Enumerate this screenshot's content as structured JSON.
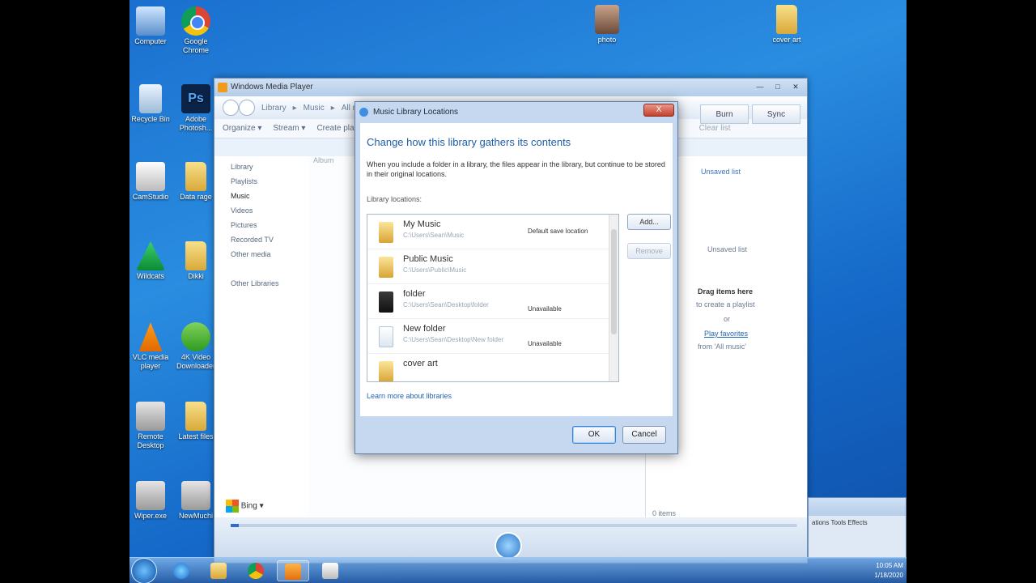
{
  "desktop": {
    "icons": [
      {
        "label": "Computer"
      },
      {
        "label": "Google Chrome"
      },
      {
        "label": "photo"
      },
      {
        "label": "cover art"
      },
      {
        "label": "Recycle Bin"
      },
      {
        "label": "Adobe Photosh..."
      },
      {
        "label": "CamStudio"
      },
      {
        "label": "Data rage"
      },
      {
        "label": "Wildcats"
      },
      {
        "label": "Dikki"
      },
      {
        "label": "VLC media player"
      },
      {
        "label": "4K Video Downloader"
      },
      {
        "label": "Remote Desktop"
      },
      {
        "label": "Latest files"
      },
      {
        "label": "Wiper.exe"
      },
      {
        "label": "NewMuchi"
      }
    ]
  },
  "wmp": {
    "title": "Windows Media Player",
    "breadcrumb": [
      "Library",
      "Music",
      "All m"
    ],
    "tabs": [
      "Burn",
      "Sync"
    ],
    "toolbar": [
      "Organize",
      "Stream",
      "Create pla"
    ],
    "clear_list": "Clear list",
    "column_header": "Album",
    "sidebar": [
      "Library",
      "Playlists",
      "Music",
      "Videos",
      "Pictures",
      "Recorded TV",
      "Other media",
      "Other Libraries"
    ],
    "right_panel": {
      "unsaved_list_link": "Unsaved list",
      "unsaved_list_title": "Unsaved list",
      "drag_title": "Drag items here",
      "drag_sub": "to create a playlist",
      "or": "or",
      "play_favorites": "Play favorites",
      "play_favorites_from": "from 'All music'",
      "item_count": "0 items"
    },
    "bing": "Bing"
  },
  "dialog": {
    "title": "Music Library Locations",
    "close_label": "X",
    "heading": "Change how this library gathers its contents",
    "description": "When you include a folder in a library, the files appear in the library, but continue to be stored in their original locations.",
    "locations_label": "Library locations:",
    "locations": [
      {
        "name": "My Music",
        "path": "C:\\Users\\Sean\\Music",
        "status": "Default save location"
      },
      {
        "name": "Public Music",
        "path": "C:\\Users\\Public\\Music",
        "status": ""
      },
      {
        "name": "folder",
        "path": "C:\\Users\\Sean\\Desktop\\folder",
        "status": "Unavailable"
      },
      {
        "name": "New folder",
        "path": "C:\\Users\\Sean\\Desktop\\New folder",
        "status": "Unavailable"
      },
      {
        "name": "cover art",
        "path": "",
        "status": ""
      }
    ],
    "add_button": "Add...",
    "remove_button": "Remove",
    "learn_more": "Learn more about libraries",
    "ok_button": "OK",
    "cancel_button": "Cancel"
  },
  "secondary_window": {
    "menu": [
      "ations",
      "Tools",
      "Effects"
    ]
  },
  "taskbar": {
    "time": "10:05 AM",
    "date": "1/18/2020"
  }
}
